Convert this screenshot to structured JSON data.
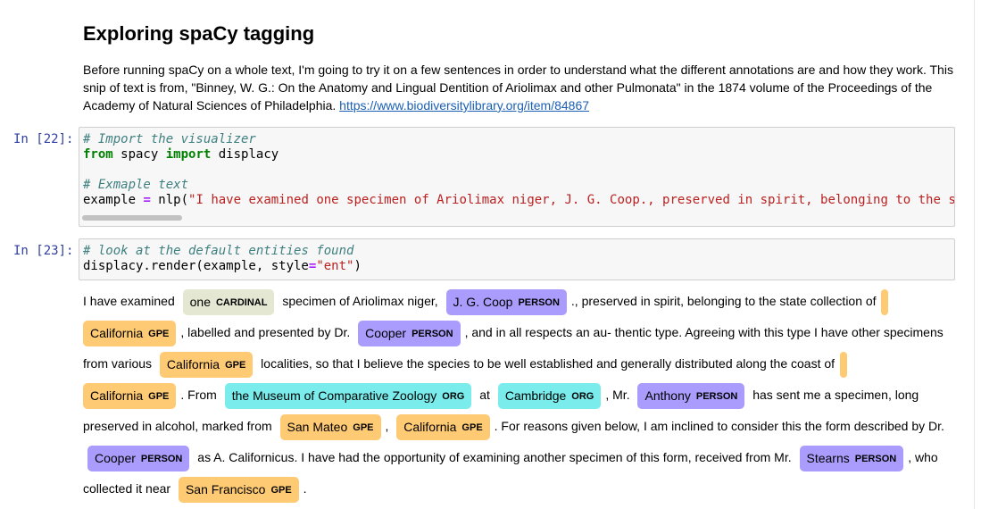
{
  "markdown": {
    "heading": "Exploring spaCy tagging",
    "paragraph": "Before running spaCy on a whole text, I'm going to try it on a few sentences in order to understand what the different annotations are and how they work. This snip of text is from, \"Binney, W. G.: On the Anatomy and Lingual Dentition of Ariolimax and other Pulmonata\" in the 1874 volume of the Proceedings of the Academy of Natural Sciences of Philadelphia.",
    "link": "https://www.biodiversitylibrary.org/item/84867"
  },
  "cell22": {
    "prompt": "In [22]:",
    "line1": "# Import the visualizer",
    "line2_kw1": "from",
    "line2_mod": " spacy ",
    "line2_kw2": "import",
    "line2_name": " displacy",
    "line3": "# Exmaple text",
    "line4_var": "example ",
    "line4_op": "=",
    "line4_call": " nlp(",
    "line4_str": "\"I have examined one specimen of Ariolimax niger, J. G. Coop., preserved in spirit, belonging to the s"
  },
  "cell23": {
    "prompt": "In [23]:",
    "line1": "# look at the default entities found",
    "line2_pre": "displacy.render(example, style",
    "line2_op": "=",
    "line2_str": "\"ent\"",
    "line2_post": ")"
  },
  "output": {
    "t1": "I have examined ",
    "e1": {
      "text": "one",
      "label": "CARDINAL"
    },
    "t2": " specimen of Ariolimax niger, ",
    "e2": {
      "text": "J. G. Coop",
      "label": "PERSON"
    },
    "t3": "., preserved in spirit, belonging to the state collection of ",
    "e3": {
      "text": "California",
      "label": "GPE"
    },
    "t4": ", labelled and presented by Dr. ",
    "e4": {
      "text": "Cooper",
      "label": "PERSON"
    },
    "t5": ", and in all respects an au- thentic type. Agreeing with this type I have other specimens from various ",
    "e5": {
      "text": "California",
      "label": "GPE"
    },
    "t6": " localities, so that I believe the species to be well established and generally distributed along the coast of ",
    "e6": {
      "text": "California",
      "label": "GPE"
    },
    "t7": ". From ",
    "e7": {
      "text": "the Museum of Comparative Zoology",
      "label": "ORG"
    },
    "t8": " at ",
    "e8": {
      "text": "Cambridge",
      "label": "ORG"
    },
    "t9": ", Mr. ",
    "e9": {
      "text": "Anthony",
      "label": "PERSON"
    },
    "t10": " has sent me a specimen, long preserved in alcohol, marked from ",
    "e10": {
      "text": "San Mateo",
      "label": "GPE"
    },
    "t11": ", ",
    "e11": {
      "text": "California",
      "label": "GPE"
    },
    "t12": ". For reasons given below, I am inclined to consider this the form described by Dr. ",
    "e12": {
      "text": "Cooper",
      "label": "PERSON"
    },
    "t13": " as A. Californicus. I have had the opportunity of examining another specimen of this form, received from Mr. ",
    "e13": {
      "text": "Stearns",
      "label": "PERSON"
    },
    "t14": ", who collected it near ",
    "e14": {
      "text": "San Francisco",
      "label": "GPE"
    },
    "t15": "."
  },
  "colors": {
    "CARDINAL": "#e4e7d2",
    "PERSON": "#aa9cfc",
    "GPE": "#feca74",
    "ORG": "#7aecec"
  }
}
